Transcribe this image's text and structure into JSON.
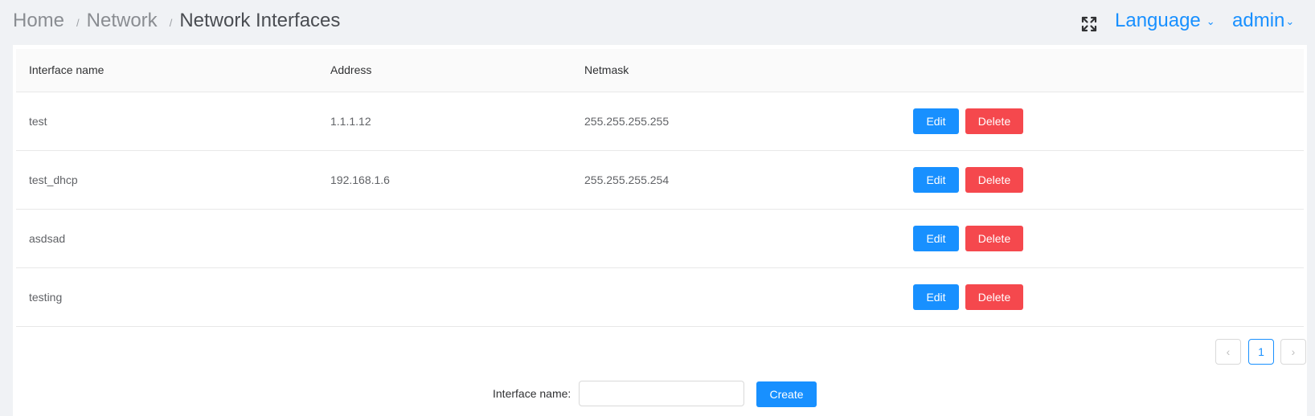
{
  "breadcrumb": {
    "home": "Home",
    "network": "Network",
    "current": "Network Interfaces",
    "separator": "/"
  },
  "header": {
    "fullscreen_icon": "fullscreen-icon",
    "language_label": "Language",
    "user_label": "admin",
    "caret": "⌄"
  },
  "table": {
    "columns": [
      "Interface name",
      "Address",
      "Netmask",
      ""
    ],
    "rows": [
      {
        "name": "test",
        "address": "1.1.1.12",
        "netmask": "255.255.255.255"
      },
      {
        "name": "test_dhcp",
        "address": "192.168.1.6",
        "netmask": "255.255.255.254"
      },
      {
        "name": "asdsad",
        "address": "",
        "netmask": ""
      },
      {
        "name": "testing",
        "address": "",
        "netmask": ""
      }
    ],
    "edit_label": "Edit",
    "delete_label": "Delete"
  },
  "pagination": {
    "prev": "‹",
    "current_page": "1",
    "next": "›"
  },
  "create_form": {
    "label": "Interface name",
    "colon": ":",
    "value": "",
    "placeholder": "",
    "button_label": "Create"
  },
  "colors": {
    "primary": "#1890ff",
    "danger": "#f5484d",
    "background": "#f0f2f5"
  }
}
